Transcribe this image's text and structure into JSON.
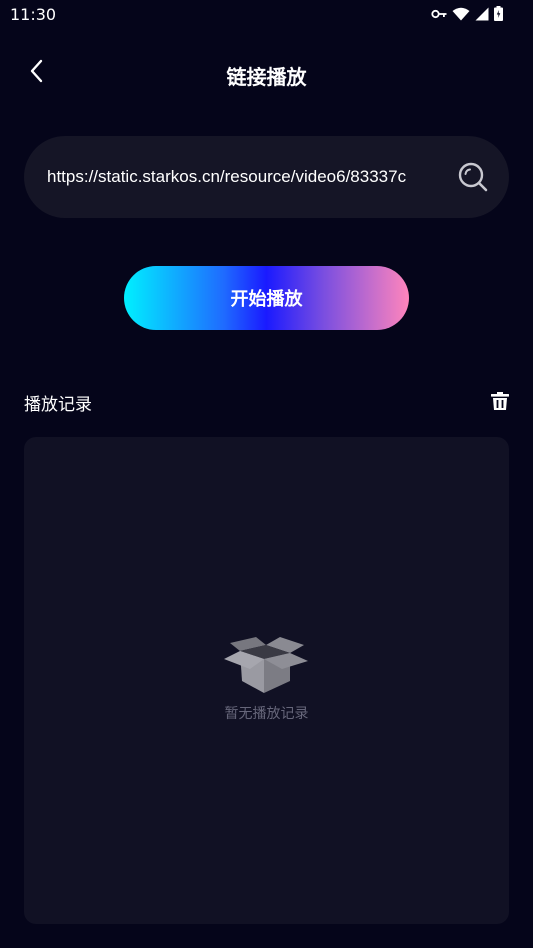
{
  "status_bar": {
    "time": "11:30",
    "icons": [
      "vpn-key-icon",
      "wifi-icon",
      "signal-icon",
      "battery-icon"
    ]
  },
  "header": {
    "title": "链接播放",
    "back_icon": "chevron-left-icon"
  },
  "url_input": {
    "value": "https://static.starkos.cn/resource/video6/83337c",
    "search_icon": "search-icon"
  },
  "play_button": {
    "label": "开始播放",
    "gradient": [
      "#00f0ff",
      "#1a1aff",
      "#ff85bc"
    ]
  },
  "history": {
    "title": "播放记录",
    "clear_icon": "trash-icon",
    "empty_icon": "open-box-icon",
    "empty_text": "暂无播放记录"
  },
  "colors": {
    "background": "#05051a",
    "panel": "#111124",
    "input_bg": "#151526",
    "muted_text": "#66667a"
  }
}
